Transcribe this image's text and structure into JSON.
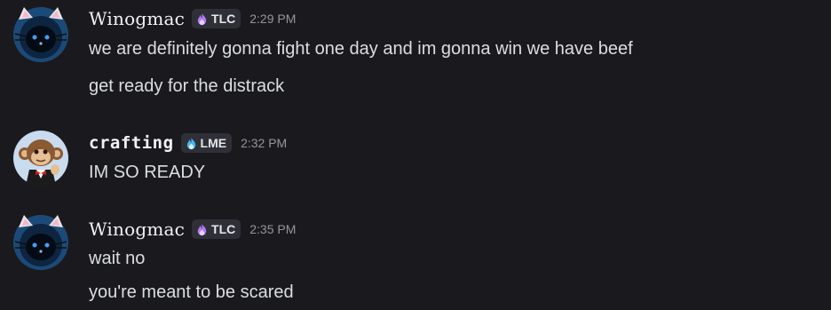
{
  "messages": [
    {
      "username": "Winogmac",
      "tag": "TLC",
      "tag_color": "#b37bf5",
      "timestamp": "2:29 PM",
      "avatar": "black-cat-avatar-icon",
      "lines": [
        "we are definitely gonna fight one day and im gonna win we have beef",
        "get ready for the distrack"
      ]
    },
    {
      "username": "crafting",
      "tag": "LME",
      "tag_color": "#48b4f0",
      "timestamp": "2:32 PM",
      "avatar": "monkey-avatar-icon",
      "lines": [
        "IM SO READY"
      ]
    },
    {
      "username": "Winogmac",
      "tag": "TLC",
      "tag_color": "#b37bf5",
      "timestamp": "2:35 PM",
      "avatar": "black-cat-avatar-icon",
      "lines": [
        "wait no",
        "you're meant to be scared"
      ]
    }
  ],
  "colors": {
    "background": "#1a1a1e",
    "text": "#dbdee1",
    "username": "#f2f3f5",
    "timestamp": "#94969c",
    "tag_bg": "#2f3037"
  }
}
